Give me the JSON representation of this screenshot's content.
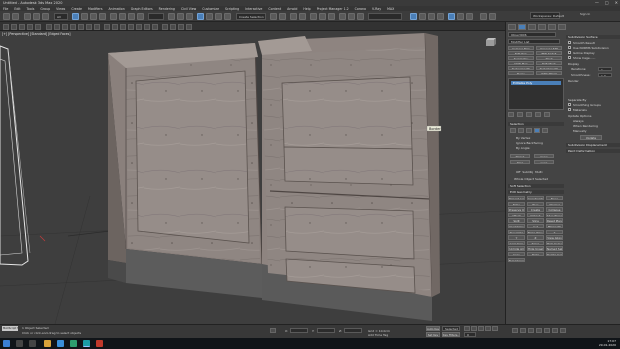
{
  "window": {
    "title": "Untitled - Autodesk 3ds Max 2020",
    "controls": [
      "—",
      "□",
      "✕"
    ]
  },
  "menu": [
    "File",
    "Edit",
    "Tools",
    "Group",
    "Views",
    "Create",
    "Modifiers",
    "Animation",
    "Graph Editors",
    "Rendering",
    "Civil View",
    "Customize",
    "Scripting",
    "Interactive",
    "Content",
    "Arnold",
    "Help",
    "Project Manager 1.2",
    "Corona",
    "V-Ray",
    "MAX"
  ],
  "toolbar": {
    "selection_filter": "All",
    "named_selection": "Create Selection Se",
    "workspace": "Workspaces: Default",
    "sign_in": "Sign In"
  },
  "viewport": {
    "label": "[+] [Perspective] [Standard] [Edged Faces]",
    "tooltip": "Border"
  },
  "command_panel": {
    "object_name": "Object006",
    "modifier_list": "Modifier List",
    "modifier_buttons": [
      "Camera Map",
      "Unwrap UVW",
      "Edit Poly",
      "FFD 3x3x3",
      "Symmetry",
      "Shell",
      "UVW Map",
      "Edit Mesh",
      "Turbosmooth",
      "TurboSmooth",
      "Noise",
      "UVW XForm"
    ],
    "stack_item": "Editable Poly",
    "rollouts": {
      "selection": "Selection",
      "soft_selection": "Soft Selection",
      "edit_geometry": "Edit Geometry",
      "subdivision_surface": "Subdivision Surface",
      "subdivision_displacement": "Subdivision Displacement",
      "paint_deformation": "Paint Deformation"
    },
    "selection_options": [
      "By Vertex",
      "Ignore Backfacing",
      "By Angle:",
      "Shrink",
      "Grow",
      "Ring",
      "Loop"
    ],
    "preview_selection": [
      "Off",
      "SubObj",
      "Multi"
    ],
    "whole_object": "Whole Object Selected",
    "edit_geometry_buttons": [
      "Repeat Last",
      "Constraints",
      "None",
      "Edge",
      "Face",
      "Normal",
      "Preserve UVs",
      "Create",
      "Collapse",
      "Attach",
      "Detach",
      "Slice Plane",
      "Split",
      "Slice",
      "Reset Plane",
      "QuickSlice",
      "Cut",
      "MSmooth",
      "Tessellate",
      "Make Planar",
      "X",
      "Y",
      "Z",
      "View Align",
      "Grid Align",
      "Relax",
      "Hide Selected",
      "Unhide All",
      "Hide Unselected",
      "Named Selections:",
      "Copy",
      "Paste",
      "Delete Isolated Vertices",
      "Full Interactivity"
    ],
    "subdivision": {
      "smooth_result": "Smooth Result",
      "use_nurms": "Use NURMS Subdivision",
      "isoline_display": "Isoline Display",
      "show_cage": "Show Cage......",
      "display": "Display",
      "iterations_label": "Iterations:",
      "iterations": "1",
      "smoothness_label": "Smoothness:",
      "smoothness": "1.0",
      "render": "Render",
      "separate_by": "Separate By",
      "smoothing_groups": "Smoothing Groups",
      "materials": "Materials",
      "update_options": "Update Options",
      "always": "Always",
      "when_rendering": "When Rendering",
      "manually": "Manually",
      "update": "Update"
    }
  },
  "status": {
    "selection": "1 Object Selected",
    "prompt": "Click or click-and-drag to select objects",
    "x_label": "X:",
    "y_label": "Y:",
    "z_label": "Z:",
    "grid": "Grid = 10.0cm",
    "add_time_tag": "Add Time Tag",
    "auto_key": "Auto Key",
    "selected": "Selected",
    "set_key": "Set Key",
    "key_filters": "Key Filters...",
    "frame": "0",
    "maxscript": "MAXScript Mi"
  },
  "taskbar": {
    "time": "17:07",
    "date": "29.01.2020"
  },
  "colors": {
    "wood": "#8f8682",
    "wood_dark": "#6e6662",
    "wood_light": "#a39a95",
    "accent": "#4a7fb8",
    "viewport_bg": "#3e3e3e"
  },
  "icons": [
    "undo-icon",
    "redo-icon",
    "link-icon",
    "unlink-icon",
    "bind-icon",
    "select-icon",
    "select-move-icon",
    "rotate-icon",
    "scale-icon",
    "snap-icon",
    "mirror-icon",
    "align-icon",
    "render-icon",
    "viewcube-icon"
  ]
}
